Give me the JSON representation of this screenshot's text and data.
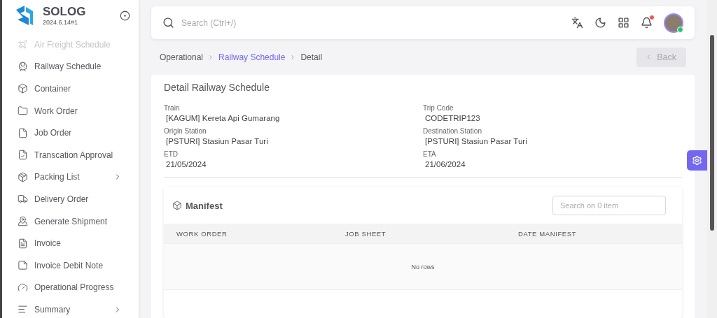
{
  "brand": {
    "name": "SOLOG",
    "version": "2024.6.14#1"
  },
  "sidebar": {
    "items": [
      {
        "kind": "plane",
        "label": "Air Freight Schedule",
        "disabled": true,
        "expandable": false
      },
      {
        "kind": "train",
        "label": "Railway Schedule",
        "disabled": false,
        "expandable": false
      },
      {
        "kind": "container",
        "label": "Container",
        "disabled": false,
        "expandable": false
      },
      {
        "kind": "folder",
        "label": "Work Order",
        "disabled": false,
        "expandable": false
      },
      {
        "kind": "file",
        "label": "Job Order",
        "disabled": false,
        "expandable": false
      },
      {
        "kind": "approval",
        "label": "Transcation Approval",
        "disabled": false,
        "expandable": false
      },
      {
        "kind": "package",
        "label": "Packing List",
        "disabled": false,
        "expandable": true
      },
      {
        "kind": "truck",
        "label": "Delivery Order",
        "disabled": false,
        "expandable": false
      },
      {
        "kind": "pin",
        "label": "Generate Shipment",
        "disabled": false,
        "expandable": false
      },
      {
        "kind": "invoice",
        "label": "Invoice",
        "disabled": false,
        "expandable": false
      },
      {
        "kind": "note",
        "label": "Invoice Debit Note",
        "disabled": false,
        "expandable": false
      },
      {
        "kind": "gauge",
        "label": "Operational Progress",
        "disabled": false,
        "expandable": false
      },
      {
        "kind": "lines",
        "label": "Summary",
        "disabled": false,
        "expandable": true
      }
    ]
  },
  "topbar": {
    "search_placeholder": "Search (Ctrl+/)",
    "notification_unread": true,
    "user_online": true
  },
  "breadcrumb": [
    {
      "label": "Operational",
      "link": false
    },
    {
      "label": "Railway Schedule",
      "link": true
    },
    {
      "label": "Detail",
      "link": false
    }
  ],
  "back_button": {
    "label": "Back",
    "disabled": true
  },
  "detail": {
    "title": "Detail Railway Schedule",
    "fields": [
      {
        "label": "Train",
        "value": "[KAGUM] Kereta Api Gumarang"
      },
      {
        "label": "Trip Code",
        "value": "CODETRIP123"
      },
      {
        "label": "Origin Station",
        "value": "[PSTURI] Stasiun Pasar Turi"
      },
      {
        "label": "Destination Station",
        "value": "[PSTURI] Stasiun Pasar Turi"
      },
      {
        "label": "ETD",
        "value": "21/05/2024"
      },
      {
        "label": "ETA",
        "value": "21/06/2024"
      }
    ]
  },
  "manifest": {
    "title": "Manifest",
    "search_placeholder": "Search on 0 item",
    "columns": [
      "WORK ORDER",
      "JOB SHEET",
      "DATE MANIFEST"
    ],
    "empty_text": "No rows"
  }
}
